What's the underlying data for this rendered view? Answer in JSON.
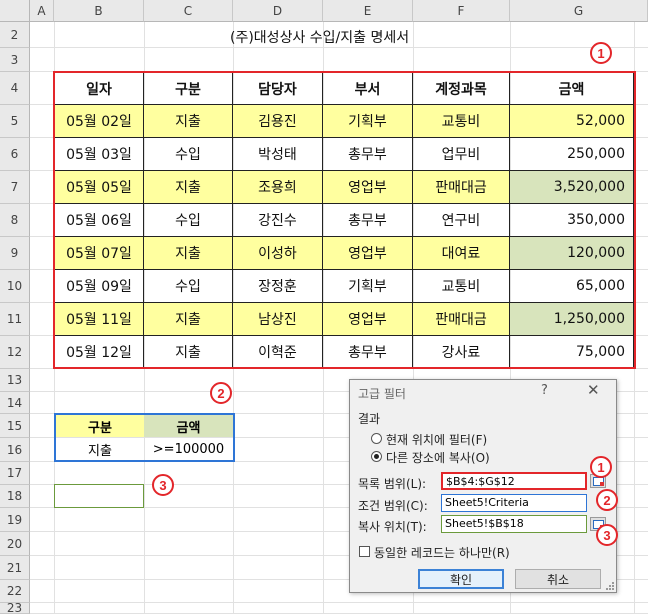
{
  "columns": [
    "A",
    "B",
    "C",
    "D",
    "E",
    "F",
    "G"
  ],
  "rows": [
    "2",
    "3",
    "4",
    "5",
    "6",
    "7",
    "8",
    "9",
    "10",
    "11",
    "12",
    "13",
    "14",
    "15",
    "16",
    "17",
    "18",
    "19",
    "20",
    "21",
    "22",
    "23"
  ],
  "sheet_title": "(주)대성상사 수입/지출 명세서",
  "table": {
    "headers": [
      "일자",
      "구분",
      "담당자",
      "부서",
      "계정과목",
      "금액"
    ],
    "rows": [
      [
        "05월 02일",
        "지출",
        "김용진",
        "기획부",
        "교통비",
        "52,000"
      ],
      [
        "05월 03일",
        "수입",
        "박성태",
        "총무부",
        "업무비",
        "250,000"
      ],
      [
        "05월 05일",
        "지출",
        "조용희",
        "영업부",
        "판매대금",
        "3,520,000"
      ],
      [
        "05월 06일",
        "수입",
        "강진수",
        "총무부",
        "연구비",
        "350,000"
      ],
      [
        "05월 07일",
        "지출",
        "이성하",
        "영업부",
        "대여료",
        "120,000"
      ],
      [
        "05월 09일",
        "수입",
        "장정훈",
        "기획부",
        "교통비",
        "65,000"
      ],
      [
        "05월 11일",
        "지출",
        "남상진",
        "영업부",
        "판매대금",
        "1,250,000"
      ],
      [
        "05월 12일",
        "지출",
        "이혁준",
        "총무부",
        "강사료",
        "75,000"
      ]
    ]
  },
  "criteria": {
    "headers": [
      "구분",
      "금액"
    ],
    "values": [
      "지출",
      ">=100000"
    ]
  },
  "badges": {
    "one": "1",
    "two": "2",
    "three": "3"
  },
  "dialog": {
    "title": "고급 필터",
    "help": "?",
    "close": "✕",
    "result_label": "결과",
    "option_inplace": "현재 위치에 필터(F)",
    "option_copy": "다른 장소에 복사(O)",
    "list_range_label": "목록 범위(L):",
    "list_range_value": "$B$4:$G$12",
    "criteria_range_label": "조건 범위(C):",
    "criteria_range_value": "Sheet5!Criteria",
    "copy_to_label": "복사 위치(T):",
    "copy_to_value": "Sheet5!$B$18",
    "unique_label": "동일한 레코드는 하나만(R)",
    "ok_label": "확인",
    "cancel_label": "취소"
  },
  "colors": {
    "highlight_yellow": "#ffff9f",
    "highlight_green": "#d8e4bc",
    "accent_red": "#e3262a",
    "accent_blue": "#2e75d6"
  }
}
